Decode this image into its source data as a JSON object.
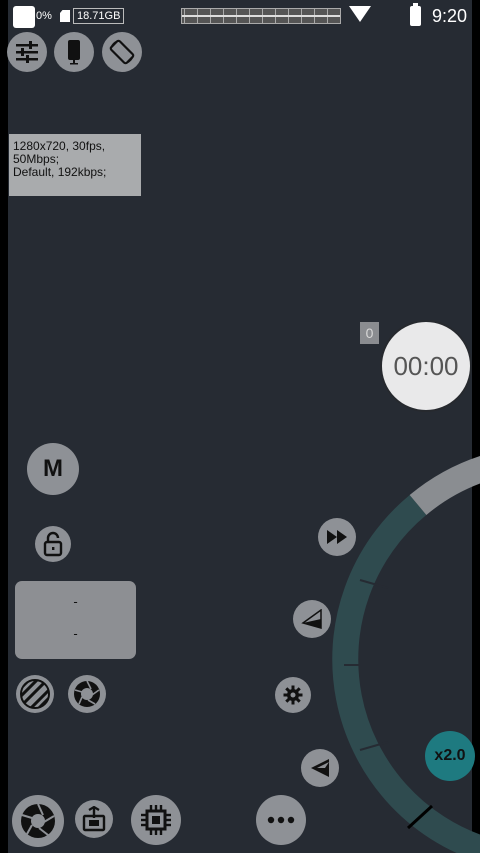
{
  "status_bar": {
    "battery_text": "0%",
    "storage": "18.71GB",
    "time": "9:20"
  },
  "toolbar_top": [
    {
      "name": "settings-sliders-icon"
    },
    {
      "name": "phone-icon"
    },
    {
      "name": "rotate-screen-icon"
    }
  ],
  "info": {
    "line1": "1280x720, 30fps,",
    "line2": "50Mbps;",
    "line3": "Default, 192kbps;"
  },
  "record": {
    "counter": "0",
    "timer": "00:00"
  },
  "mode_button": "M",
  "dash_box": {
    "line1": "-",
    "line2": "-"
  },
  "zoom": {
    "label": "x2.0",
    "level": 2.0
  },
  "colors": {
    "background": "#262b33",
    "button_grey": "#8e9196",
    "zoom_arc": "#2f4b4f",
    "zoom_badge": "#1e7a80"
  }
}
